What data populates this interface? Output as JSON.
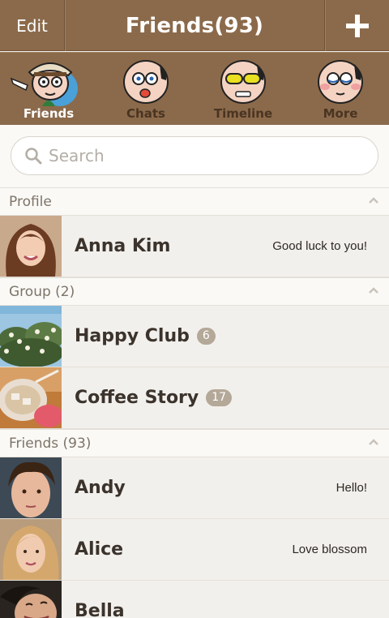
{
  "header": {
    "edit_label": "Edit",
    "title": "Friends(93)",
    "add_icon": "plus-icon"
  },
  "tabs": [
    {
      "label": "Friends",
      "active": true,
      "icon": "friends-character-icon"
    },
    {
      "label": "Chats",
      "active": false,
      "icon": "chats-character-icon"
    },
    {
      "label": "Timeline",
      "active": false,
      "icon": "timeline-character-icon"
    },
    {
      "label": "More",
      "active": false,
      "icon": "more-character-icon"
    }
  ],
  "search": {
    "placeholder": "Search",
    "icon": "search-icon"
  },
  "sections": {
    "profile": {
      "title": "Profile",
      "rows": [
        {
          "name": "Anna Kim",
          "status": "Good luck to you!"
        }
      ]
    },
    "group": {
      "title": "Group (2)",
      "rows": [
        {
          "name": "Happy Club",
          "count": "6"
        },
        {
          "name": "Coffee Story",
          "count": "17"
        }
      ]
    },
    "friends": {
      "title": "Friends (93)",
      "rows": [
        {
          "name": "Andy",
          "status": "Hello!"
        },
        {
          "name": "Alice",
          "status": "Love blossom"
        },
        {
          "name": "Bella",
          "status": ""
        }
      ]
    }
  },
  "colors": {
    "bar_brown": "#8b6a4b",
    "active_tab_text": "#ffffff",
    "inactive_tab_text": "#4a3422",
    "badge_bg": "#b4a898"
  }
}
